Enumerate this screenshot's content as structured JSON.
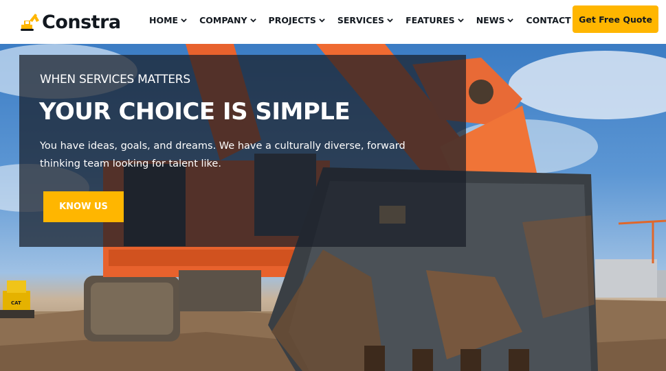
{
  "brand": {
    "name": "Constra",
    "logo_icon": "excavator-logo-icon",
    "accent_color": "#ffb600"
  },
  "nav": {
    "items": [
      {
        "label": "HOME",
        "icon": "chevron-down-icon"
      },
      {
        "label": "COMPANY",
        "icon": "chevron-down-icon"
      },
      {
        "label": "PROJECTS",
        "icon": "chevron-down-icon"
      },
      {
        "label": "SERVICES",
        "icon": "chevron-down-icon"
      },
      {
        "label": "FEATURES",
        "icon": "chevron-down-icon"
      },
      {
        "label": "NEWS",
        "icon": "chevron-down-icon"
      },
      {
        "label": "CONTACT"
      }
    ],
    "cta_label": "Get Free Quote"
  },
  "hero": {
    "kicker": "WHEN SERVICES MATTERS",
    "headline": "YOUR CHOICE IS SIMPLE",
    "lead": "You have ideas, goals, and dreams. We have a culturally diverse, forward thinking team looking for talent like.",
    "button_label": "KNOW US",
    "background_image": "excavator-photo",
    "machine_label": "CAT"
  }
}
